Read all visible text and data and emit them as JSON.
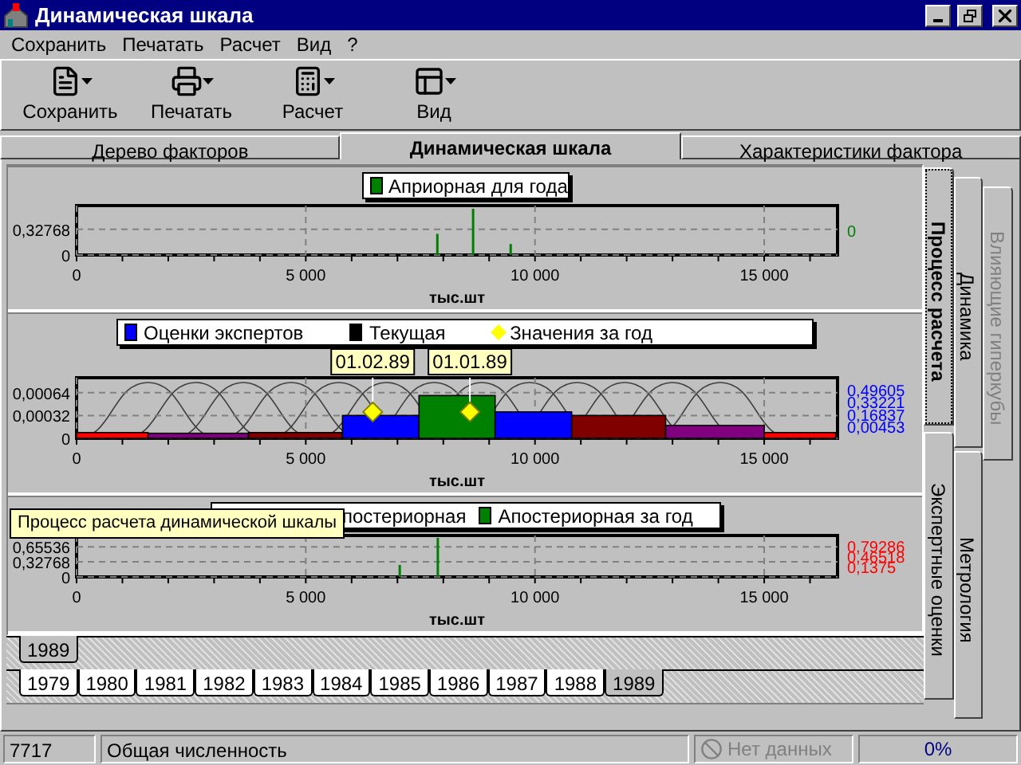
{
  "window": {
    "title": "Динамическая шкала"
  },
  "menu": [
    "Сохранить",
    "Печатать",
    "Расчет",
    "Вид",
    "?"
  ],
  "toolbar": [
    {
      "label": "Сохранить",
      "kind": "save"
    },
    {
      "label": "Печатать",
      "kind": "print"
    },
    {
      "label": "Расчет",
      "kind": "calc"
    },
    {
      "label": "Вид",
      "kind": "view"
    }
  ],
  "tabs": [
    {
      "label": "Дерево факторов",
      "selected": false
    },
    {
      "label": "Динамическая шкала",
      "selected": true
    },
    {
      "label": "Характеристики фактора",
      "selected": false
    }
  ],
  "charts": [
    {
      "legend": [
        {
          "label": "Априорная для года",
          "color": "#008000",
          "kind": "square"
        }
      ],
      "right_axis": {
        "color": "#008000",
        "labels": [
          "0"
        ]
      },
      "background_curves": false,
      "chart_data": {
        "type": "bar",
        "grid": true,
        "xlabel": "тыс.шт",
        "x": [
          7870,
          8650,
          9470
        ],
        "series": [
          {
            "color": "#008000",
            "values": [
              0.27,
              0.59,
              0.14
            ]
          }
        ],
        "xlim": [
          0,
          16600
        ],
        "ylim": [
          0,
          0.63
        ],
        "xticks": [
          {
            "value": 0,
            "label": "0"
          },
          {
            "value": 5000,
            "label": "5 000"
          },
          {
            "value": 10000,
            "label": "10 000"
          },
          {
            "value": 15000,
            "label": "15 000"
          }
        ],
        "yticks": [
          {
            "value": 0,
            "label": "0"
          },
          {
            "value": 0.32768,
            "label": "0,32768"
          }
        ]
      }
    },
    {
      "legend": [
        {
          "label": "Оценки экспертов",
          "color": "#0000ff",
          "kind": "square"
        },
        {
          "label": "Текущая",
          "color": "#000000",
          "kind": "square"
        },
        {
          "label": "Значения за год",
          "color": "#ffff00",
          "kind": "diamond"
        }
      ],
      "right_axis": {
        "color": "#0000ff",
        "labels": [
          "0,49605",
          "0,33221",
          "0,16837",
          "0,00453"
        ]
      },
      "background_curves": true,
      "chart_data": {
        "type": "bar",
        "grid": true,
        "xlabel": "тыс.шт",
        "x": [
          780,
          2655,
          4775,
          6635,
          8300,
          9965,
          11825,
          13925,
          15780
        ],
        "series": [
          {
            "colors": [
              "#ff0000",
              "#800080",
              "#800000",
              "#0000ff",
              "#008000",
              "#0000ff",
              "#800000",
              "#800080",
              "#ff0000"
            ],
            "values": [
              8e-05,
              7e-05,
              8e-05,
              0.00032,
              0.0006,
              0.00037,
              0.00032,
              0.00018,
              8e-05
            ]
          }
        ],
        "annotations": [
          {
            "x": 6460,
            "y": 0.00037,
            "text": "01.02.89"
          },
          {
            "x": 8580,
            "y": 0.00037,
            "text": "01.01.89"
          }
        ],
        "xlim": [
          0,
          16600
        ],
        "ylim": [
          0,
          0.00085
        ],
        "xticks": [
          {
            "value": 0,
            "label": "0"
          },
          {
            "value": 5000,
            "label": "5 000"
          },
          {
            "value": 10000,
            "label": "10 000"
          },
          {
            "value": 15000,
            "label": "15 000"
          }
        ],
        "yticks": [
          {
            "value": 0,
            "label": "0"
          },
          {
            "value": 0.00032,
            "label": "0,00032"
          },
          {
            "value": 0.00064,
            "label": "0,00064"
          }
        ]
      }
    },
    {
      "tooltip": "Процесс расчета динамической шкалы",
      "legend": [
        {
          "label": "постериорная",
          "kind": "hidden"
        },
        {
          "label": "Апостериорная за год",
          "color": "#008000",
          "kind": "square"
        }
      ],
      "right_axis": {
        "color": "#ff0000",
        "labels": [
          "0,79286",
          "0,46518",
          "0,1375"
        ]
      },
      "background_curves": false,
      "chart_data": {
        "type": "bar",
        "grid": true,
        "xlabel": "тыс.шт",
        "x": [
          7050,
          7880
        ],
        "series": [
          {
            "color": "#008000",
            "values": [
              0.26,
              0.85
            ]
          }
        ],
        "xlim": [
          0,
          16600
        ],
        "ylim": [
          0,
          0.9
        ],
        "xticks": [
          {
            "value": 0,
            "label": "0"
          },
          {
            "value": 5000,
            "label": "5 000"
          },
          {
            "value": 10000,
            "label": "10 000"
          },
          {
            "value": 15000,
            "label": "15 000"
          }
        ],
        "yticks": [
          {
            "value": 0,
            "label": "0"
          },
          {
            "value": 0.32768,
            "label": "0,32768"
          },
          {
            "value": 0.65536,
            "label": "0,65536"
          }
        ]
      }
    }
  ],
  "side_tabs": [
    [
      {
        "label": "Процесс расчета",
        "selected": true,
        "disabled": false
      },
      {
        "label": "Экспертные оценки",
        "selected": false,
        "disabled": false
      }
    ],
    [
      {
        "label": "Динамика",
        "selected": false,
        "disabled": false
      },
      {
        "label": "Метрология",
        "selected": false,
        "disabled": false
      }
    ],
    [
      {
        "label": "Влияющие гиперкубы",
        "selected": false,
        "disabled": true
      }
    ]
  ],
  "year_tabs": [
    [
      {
        "label": "1989",
        "selected": true
      }
    ],
    [
      {
        "label": "1979",
        "selected": false
      },
      {
        "label": "1980",
        "selected": false
      },
      {
        "label": "1981",
        "selected": false
      },
      {
        "label": "1982",
        "selected": false
      },
      {
        "label": "1983",
        "selected": false
      },
      {
        "label": "1984",
        "selected": false
      },
      {
        "label": "1985",
        "selected": false
      },
      {
        "label": "1986",
        "selected": false
      },
      {
        "label": "1987",
        "selected": false
      },
      {
        "label": "1988",
        "selected": false
      },
      {
        "label": "1989",
        "selected": true
      }
    ]
  ],
  "status_bar": {
    "count": "7717",
    "description": "Общая численность",
    "data_status": "Нет данных",
    "progress": "0%",
    "level": 0
  }
}
